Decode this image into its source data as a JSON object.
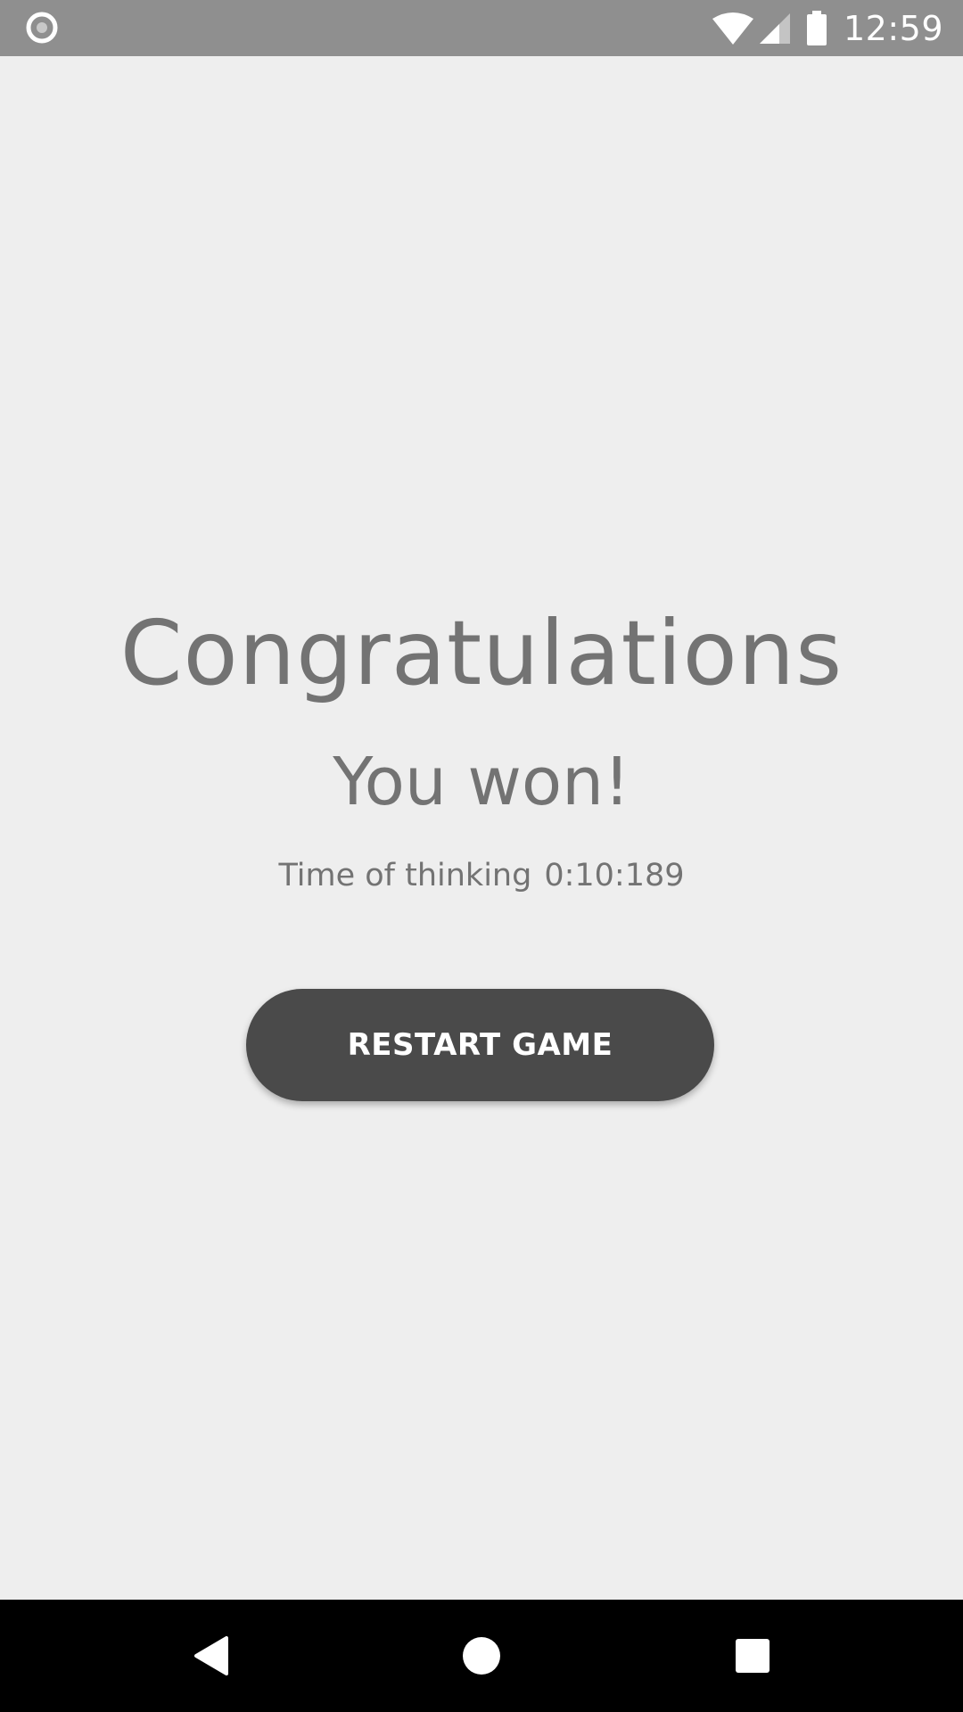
{
  "status_bar": {
    "time": "12:59",
    "icons": [
      "record-icon",
      "wifi-icon",
      "cell-signal-icon",
      "battery-icon"
    ],
    "background": "#8f8f8f"
  },
  "main": {
    "title": "Congratulations",
    "subtitle": "You won!",
    "time_label": "Time of thinking",
    "time_value": "0:10:189",
    "text_color": "#737373"
  },
  "actions": {
    "restart_label": "RESTART GAME",
    "button_color": "#4a4a4a"
  },
  "nav_bar": {
    "icons": [
      "back-icon",
      "home-icon",
      "recents-icon"
    ]
  }
}
